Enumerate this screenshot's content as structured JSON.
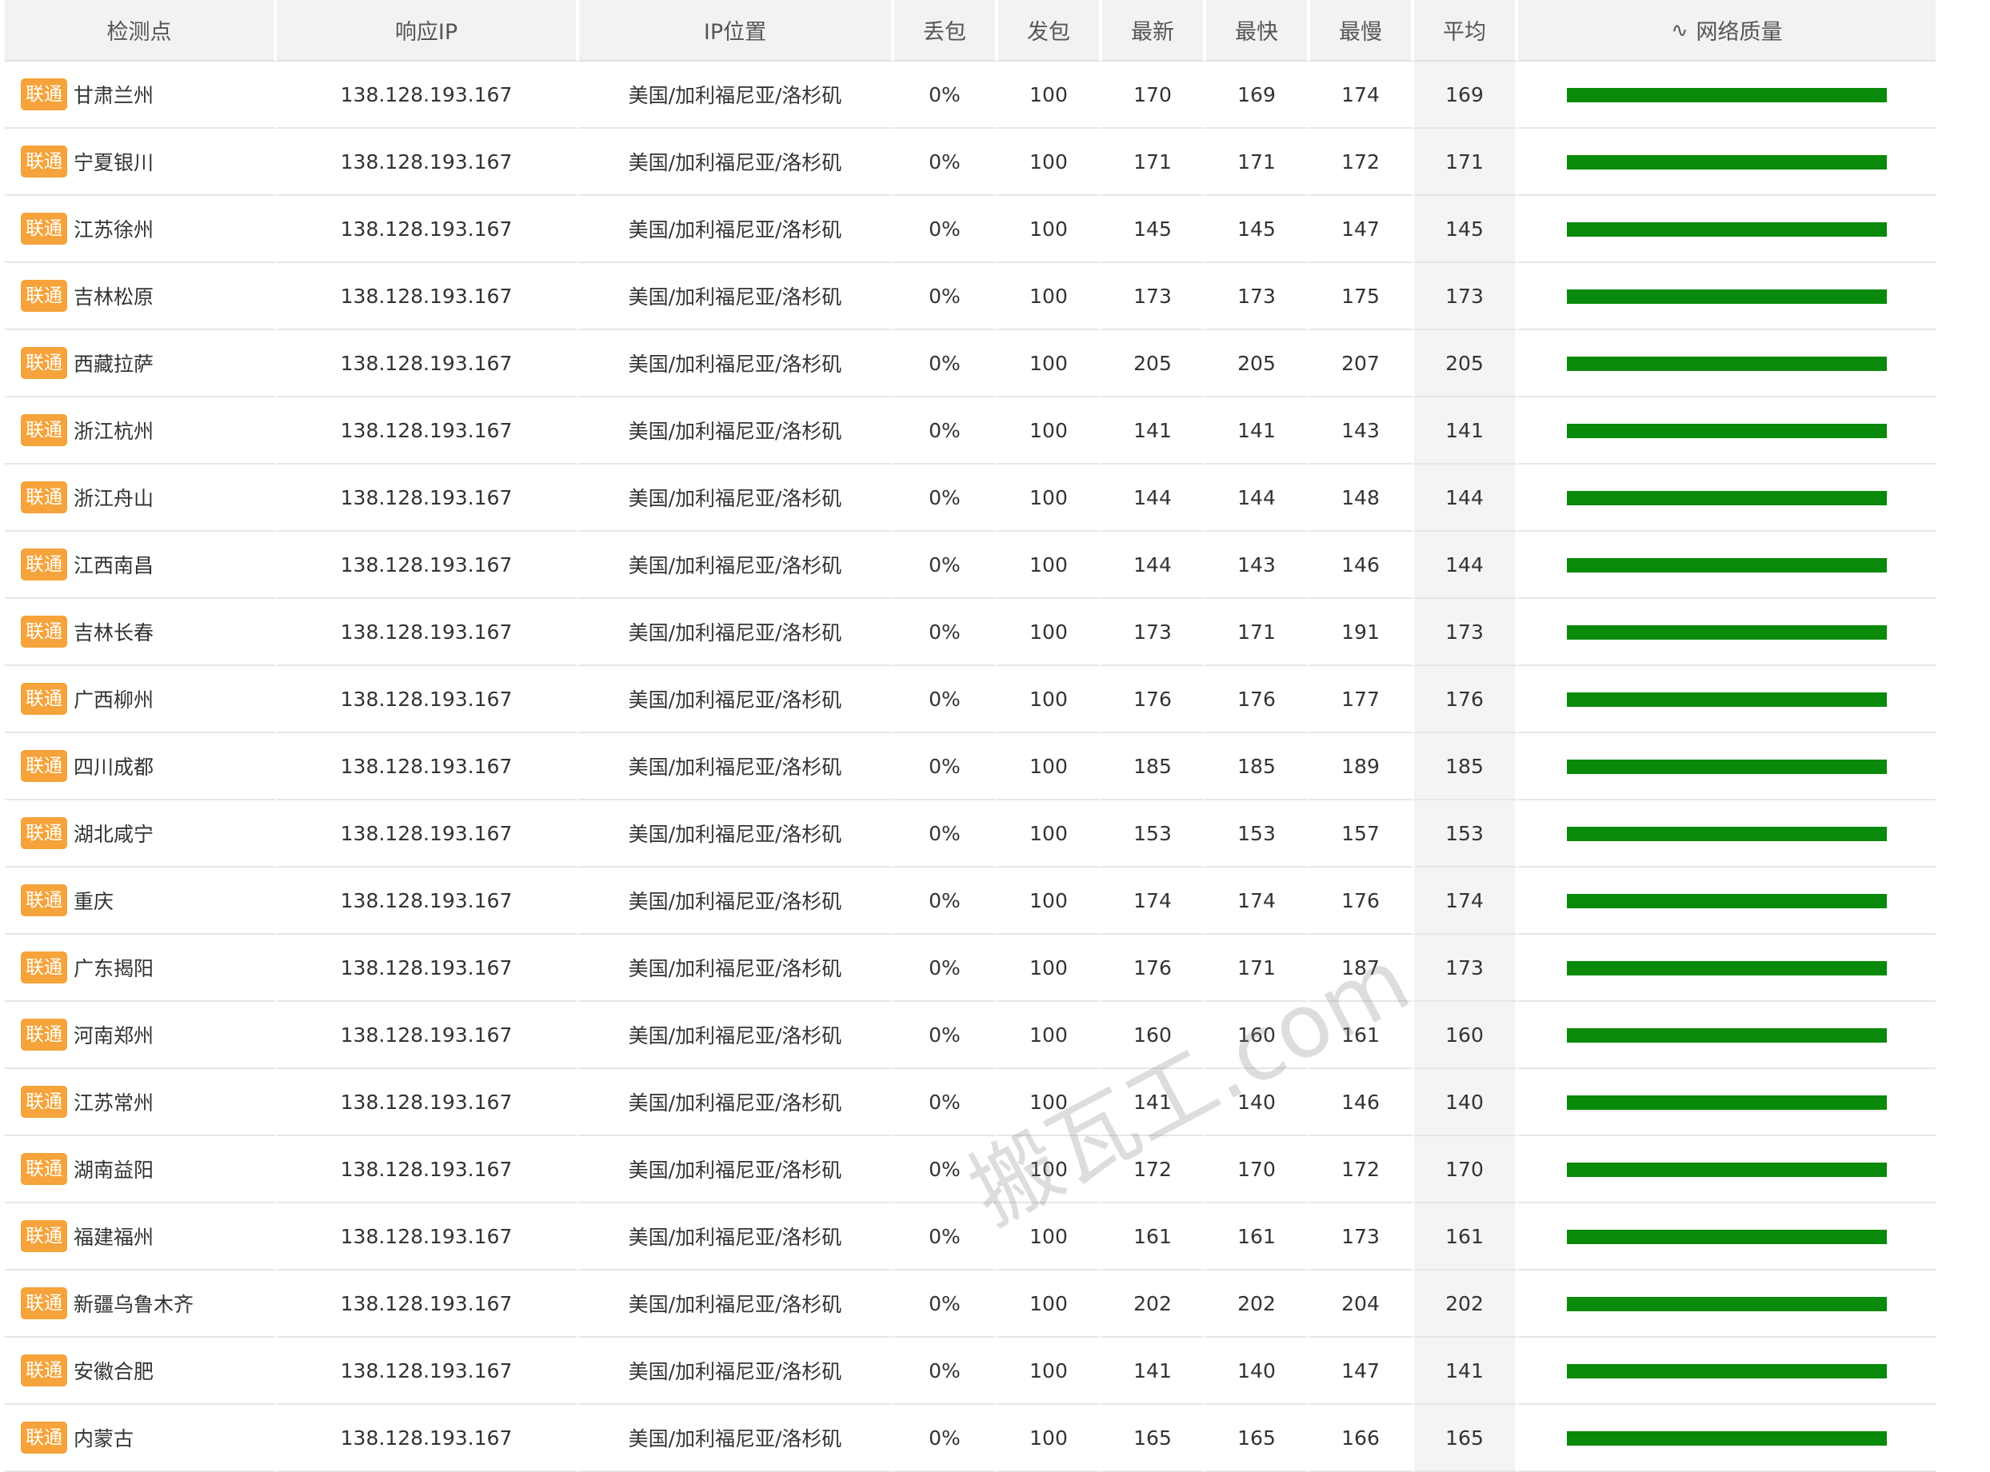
{
  "headers": [
    "检测点",
    "响应IP",
    "IP位置",
    "丢包",
    "发包",
    "最新",
    "最快",
    "最慢",
    "平均",
    "网络质量"
  ],
  "watermark": "搬瓦工.com",
  "bar_color": "#0a8a0a",
  "badge_color": "#f5a33a",
  "rows": [
    {
      "isp": "联通",
      "city": "甘肃兰州",
      "ip": "138.128.193.167",
      "loc": "美国/加利福尼亚/洛杉矶",
      "loss": "0%",
      "sent": "100",
      "last": "170",
      "best": "169",
      "worst": "174",
      "avg": "169",
      "quality": 1.0
    },
    {
      "isp": "联通",
      "city": "宁夏银川",
      "ip": "138.128.193.167",
      "loc": "美国/加利福尼亚/洛杉矶",
      "loss": "0%",
      "sent": "100",
      "last": "171",
      "best": "171",
      "worst": "172",
      "avg": "171",
      "quality": 1.0
    },
    {
      "isp": "联通",
      "city": "江苏徐州",
      "ip": "138.128.193.167",
      "loc": "美国/加利福尼亚/洛杉矶",
      "loss": "0%",
      "sent": "100",
      "last": "145",
      "best": "145",
      "worst": "147",
      "avg": "145",
      "quality": 1.0
    },
    {
      "isp": "联通",
      "city": "吉林松原",
      "ip": "138.128.193.167",
      "loc": "美国/加利福尼亚/洛杉矶",
      "loss": "0%",
      "sent": "100",
      "last": "173",
      "best": "173",
      "worst": "175",
      "avg": "173",
      "quality": 1.0
    },
    {
      "isp": "联通",
      "city": "西藏拉萨",
      "ip": "138.128.193.167",
      "loc": "美国/加利福尼亚/洛杉矶",
      "loss": "0%",
      "sent": "100",
      "last": "205",
      "best": "205",
      "worst": "207",
      "avg": "205",
      "quality": 1.0
    },
    {
      "isp": "联通",
      "city": "浙江杭州",
      "ip": "138.128.193.167",
      "loc": "美国/加利福尼亚/洛杉矶",
      "loss": "0%",
      "sent": "100",
      "last": "141",
      "best": "141",
      "worst": "143",
      "avg": "141",
      "quality": 1.0
    },
    {
      "isp": "联通",
      "city": "浙江舟山",
      "ip": "138.128.193.167",
      "loc": "美国/加利福尼亚/洛杉矶",
      "loss": "0%",
      "sent": "100",
      "last": "144",
      "best": "144",
      "worst": "148",
      "avg": "144",
      "quality": 1.0
    },
    {
      "isp": "联通",
      "city": "江西南昌",
      "ip": "138.128.193.167",
      "loc": "美国/加利福尼亚/洛杉矶",
      "loss": "0%",
      "sent": "100",
      "last": "144",
      "best": "143",
      "worst": "146",
      "avg": "144",
      "quality": 1.0
    },
    {
      "isp": "联通",
      "city": "吉林长春",
      "ip": "138.128.193.167",
      "loc": "美国/加利福尼亚/洛杉矶",
      "loss": "0%",
      "sent": "100",
      "last": "173",
      "best": "171",
      "worst": "191",
      "avg": "173",
      "quality": 1.0
    },
    {
      "isp": "联通",
      "city": "广西柳州",
      "ip": "138.128.193.167",
      "loc": "美国/加利福尼亚/洛杉矶",
      "loss": "0%",
      "sent": "100",
      "last": "176",
      "best": "176",
      "worst": "177",
      "avg": "176",
      "quality": 1.0
    },
    {
      "isp": "联通",
      "city": "四川成都",
      "ip": "138.128.193.167",
      "loc": "美国/加利福尼亚/洛杉矶",
      "loss": "0%",
      "sent": "100",
      "last": "185",
      "best": "185",
      "worst": "189",
      "avg": "185",
      "quality": 1.0
    },
    {
      "isp": "联通",
      "city": "湖北咸宁",
      "ip": "138.128.193.167",
      "loc": "美国/加利福尼亚/洛杉矶",
      "loss": "0%",
      "sent": "100",
      "last": "153",
      "best": "153",
      "worst": "157",
      "avg": "153",
      "quality": 1.0
    },
    {
      "isp": "联通",
      "city": "重庆",
      "ip": "138.128.193.167",
      "loc": "美国/加利福尼亚/洛杉矶",
      "loss": "0%",
      "sent": "100",
      "last": "174",
      "best": "174",
      "worst": "176",
      "avg": "174",
      "quality": 1.0
    },
    {
      "isp": "联通",
      "city": "广东揭阳",
      "ip": "138.128.193.167",
      "loc": "美国/加利福尼亚/洛杉矶",
      "loss": "0%",
      "sent": "100",
      "last": "176",
      "best": "171",
      "worst": "187",
      "avg": "173",
      "quality": 1.0
    },
    {
      "isp": "联通",
      "city": "河南郑州",
      "ip": "138.128.193.167",
      "loc": "美国/加利福尼亚/洛杉矶",
      "loss": "0%",
      "sent": "100",
      "last": "160",
      "best": "160",
      "worst": "161",
      "avg": "160",
      "quality": 1.0
    },
    {
      "isp": "联通",
      "city": "江苏常州",
      "ip": "138.128.193.167",
      "loc": "美国/加利福尼亚/洛杉矶",
      "loss": "0%",
      "sent": "100",
      "last": "141",
      "best": "140",
      "worst": "146",
      "avg": "140",
      "quality": 1.0
    },
    {
      "isp": "联通",
      "city": "湖南益阳",
      "ip": "138.128.193.167",
      "loc": "美国/加利福尼亚/洛杉矶",
      "loss": "0%",
      "sent": "100",
      "last": "172",
      "best": "170",
      "worst": "172",
      "avg": "170",
      "quality": 1.0
    },
    {
      "isp": "联通",
      "city": "福建福州",
      "ip": "138.128.193.167",
      "loc": "美国/加利福尼亚/洛杉矶",
      "loss": "0%",
      "sent": "100",
      "last": "161",
      "best": "161",
      "worst": "173",
      "avg": "161",
      "quality": 1.0
    },
    {
      "isp": "联通",
      "city": "新疆乌鲁木齐",
      "ip": "138.128.193.167",
      "loc": "美国/加利福尼亚/洛杉矶",
      "loss": "0%",
      "sent": "100",
      "last": "202",
      "best": "202",
      "worst": "204",
      "avg": "202",
      "quality": 1.0
    },
    {
      "isp": "联通",
      "city": "安徽合肥",
      "ip": "138.128.193.167",
      "loc": "美国/加利福尼亚/洛杉矶",
      "loss": "0%",
      "sent": "100",
      "last": "141",
      "best": "140",
      "worst": "147",
      "avg": "141",
      "quality": 1.0
    },
    {
      "isp": "联通",
      "city": "内蒙古",
      "ip": "138.128.193.167",
      "loc": "美国/加利福尼亚/洛杉矶",
      "loss": "0%",
      "sent": "100",
      "last": "165",
      "best": "165",
      "worst": "166",
      "avg": "165",
      "quality": 1.0
    }
  ]
}
